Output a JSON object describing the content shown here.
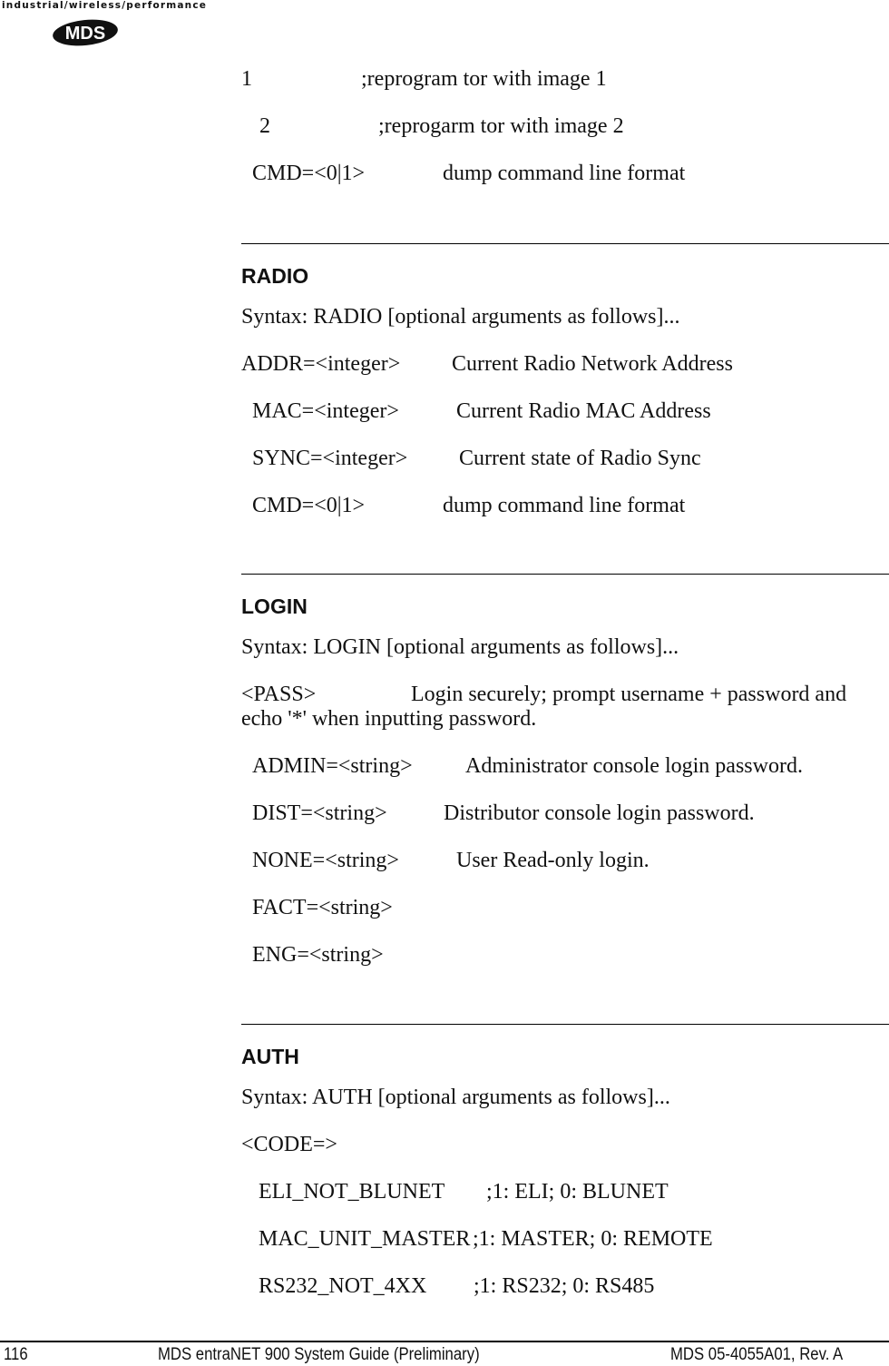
{
  "header": {
    "tagline": "industrial/wireless/performance",
    "logo_text": "MDS"
  },
  "intro_lines": [
    {
      "arg": "1",
      "desc": ";reprogram tor with image 1"
    },
    {
      "arg": "2",
      "desc": ";reprogarm tor with image 2"
    },
    {
      "arg": "CMD=<0|1>",
      "desc": "dump command line format"
    }
  ],
  "sections": {
    "radio": {
      "title": "RADIO",
      "syntax": "Syntax: RADIO [optional arguments as follows]...",
      "args": [
        {
          "arg": "ADDR=<integer>",
          "desc": "Current Radio Network Address"
        },
        {
          "arg": "MAC=<integer>",
          "desc": "Current Radio MAC Address"
        },
        {
          "arg": "SYNC=<integer>",
          "desc": "Current state of Radio Sync"
        },
        {
          "arg": "CMD=<0|1>",
          "desc": "dump command line format"
        }
      ]
    },
    "login": {
      "title": "LOGIN",
      "syntax": "Syntax: LOGIN [optional arguments as follows]...",
      "pass_arg": "<PASS>",
      "pass_desc_1": "Login securely; prompt username + password and",
      "pass_desc_2": "echo '*' when inputting password.",
      "args": [
        {
          "arg": "ADMIN=<string>",
          "desc": "Administrator console login password."
        },
        {
          "arg": "DIST=<string>",
          "desc": "Distributor console login password."
        },
        {
          "arg": "NONE=<string>",
          "desc": "User Read-only login."
        },
        {
          "arg": "FACT=<string>",
          "desc": ""
        },
        {
          "arg": "ENG=<string>",
          "desc": ""
        }
      ]
    },
    "auth": {
      "title": "AUTH",
      "syntax": "Syntax: AUTH [optional arguments as follows]...",
      "code_arg": "<CODE=>",
      "args": [
        {
          "arg": "ELI_NOT_BLUNET",
          "desc": ";1: ELI; 0: BLUNET"
        },
        {
          "arg": "MAC_UNIT_MASTER",
          "desc": ";1: MASTER; 0: REMOTE"
        },
        {
          "arg": "RS232_NOT_4XX",
          "desc": ";1: RS232; 0: RS485"
        }
      ]
    }
  },
  "footer": {
    "page_number": "116",
    "doc_title": "MDS entraNET 900 System Guide (Preliminary)",
    "doc_id": "MDS 05-4055A01, Rev. A"
  }
}
